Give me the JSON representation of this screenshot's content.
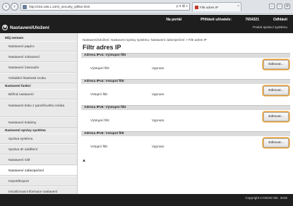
{
  "browser": {
    "url": "http://192.168.1.24/m_security_ipfilter.html",
    "tab_label": "Filtr adres IP",
    "tab_close": "×",
    "back_icon": "‹",
    "forward_icon": "›",
    "url_tools": "ρ ▾ ⊠ c",
    "icons": [
      "home-icon",
      "star-icon",
      "gear-icon"
    ]
  },
  "header": {
    "portal": "Na portál",
    "login_label": "Přihlásit uživatele:",
    "login_id": "7654321",
    "logout": "Odhlásit",
    "app_title": "Nastavení/Uložení",
    "admin_link": "Poslat správci systému"
  },
  "sidebar": {
    "groups": [
      {
        "heading": "Můj seznam",
        "items": [
          "Nastavení papíru",
          "Nastavení zobrazení",
          "Nastavení časovače",
          "Ovládání hlasitosti zvuku"
        ]
      },
      {
        "heading": "Nastavení funkcí",
        "items": [
          "Běžná nastavení",
          "Nastavení tisku z paměťového média",
          "Nastavení tiskárny"
        ]
      },
      {
        "heading": "Nastavení správy systému",
        "items": [
          "Správa systému",
          "Správa ID oddělení",
          "Nastavení sítě",
          "Nastavení zabezpečení",
          "Import/Export",
          "Inicializovat informace nastavení"
        ]
      }
    ],
    "active": "Nastavení zabezpečení"
  },
  "main": {
    "breadcrumb": "Nastavení/Uložení: Nastavení správy systému: Nastavení zabezpečení > Filtr adres IP",
    "title": "Filtr adres IP",
    "sections": [
      {
        "heading": "Adresa IPv4: Výstupní filtr",
        "label": "Výstupní filtr:",
        "value": "Vypnuto",
        "button": "Editovat..."
      },
      {
        "heading": "Adresa IPv4: Vstupní filtr",
        "label": "Vstupní filtr:",
        "value": "Vypnuto",
        "button": "Editovat..."
      },
      {
        "heading": "Adresa IPv6: Výstupní filtr",
        "label": "Výstupní filtr:",
        "value": "Vypnuto",
        "button": "Editovat..."
      },
      {
        "heading": "Adresa IPv6: Vstupní filtr",
        "label": "Vstupní filtr:",
        "value": "Vypnuto",
        "button": "Editovat..."
      }
    ],
    "to_top": "▲"
  },
  "footer": {
    "copyright": "Copyright CANON INC. 2015"
  },
  "colors": {
    "header_bg": "#1e1e1e",
    "sidebar_bg": "#e9e9e9",
    "button_highlight": "#e89a2a"
  }
}
